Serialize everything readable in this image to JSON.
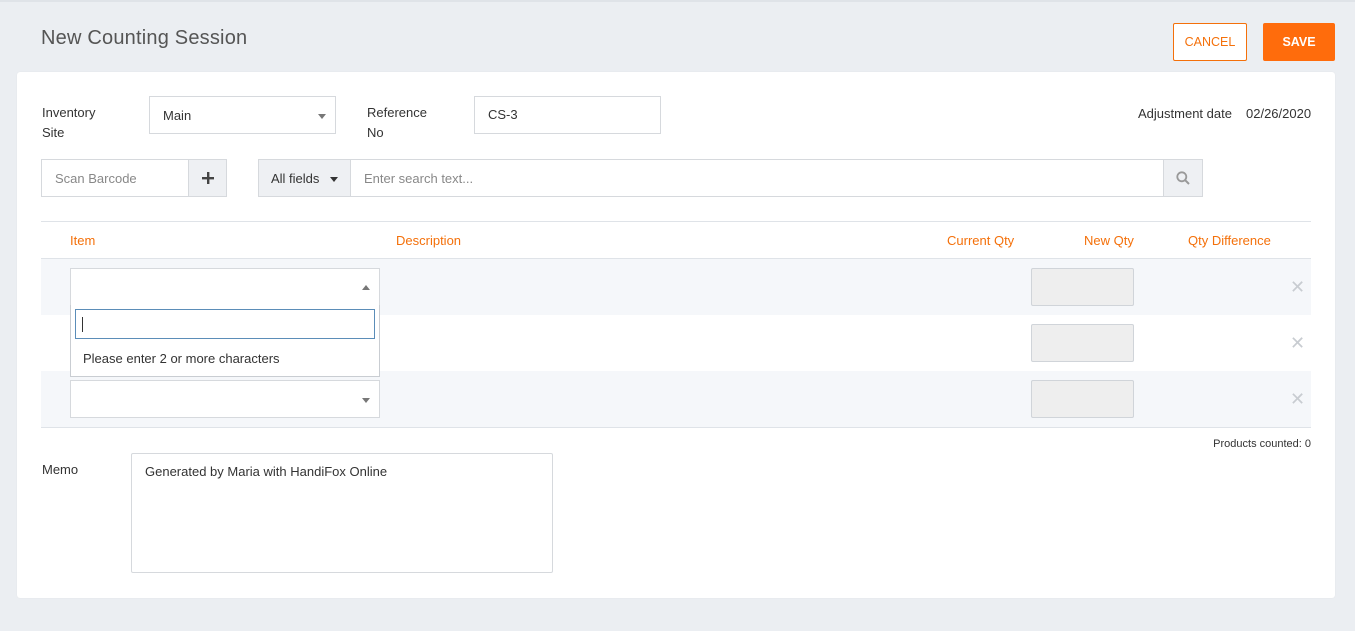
{
  "header": {
    "title": "New Counting Session",
    "cancel_label": "CANCEL",
    "save_label": "SAVE"
  },
  "form": {
    "inventory_site_label_1": "Inventory",
    "inventory_site_label_2": "Site",
    "inventory_site_value": "Main",
    "reference_label_1": "Reference",
    "reference_label_2": "No",
    "reference_value": "CS-3",
    "adjustment_date_label": "Adjustment date",
    "adjustment_date_value": "02/26/2020"
  },
  "search": {
    "barcode_placeholder": "Scan Barcode",
    "field_filter": "All fields",
    "search_placeholder": "Enter search text..."
  },
  "table": {
    "columns": [
      "Item",
      "Description",
      "Current Qty",
      "New Qty",
      "Qty Difference"
    ],
    "rows": [
      {
        "item": "",
        "description": "",
        "current_qty": "",
        "new_qty": "",
        "qty_difference": ""
      },
      {
        "item": "",
        "description": "",
        "current_qty": "",
        "new_qty": "",
        "qty_difference": ""
      },
      {
        "item": "",
        "description": "",
        "current_qty": "",
        "new_qty": "",
        "qty_difference": ""
      }
    ],
    "dropdown_message": "Please enter 2 or more characters",
    "products_counted": "Products counted: 0"
  },
  "memo": {
    "label": "Memo",
    "value": "Generated by Maria with HandiFox Online"
  },
  "colors": {
    "accent": "#ff6c0c",
    "header_text": "#f4700a",
    "background": "#ebeef2"
  },
  "icons": {
    "plus": "plus-icon",
    "search": "search-icon",
    "remove": "close-icon",
    "caret": "caret-down-icon"
  }
}
